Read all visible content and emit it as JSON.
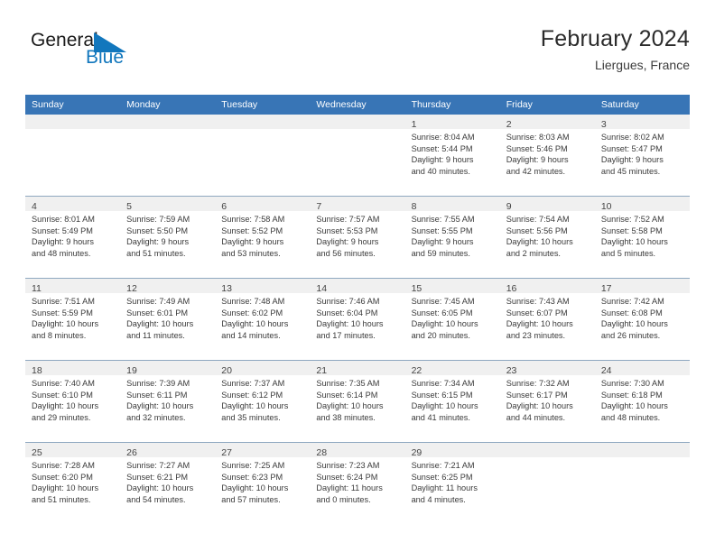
{
  "logo": {
    "word_top": "General",
    "word_bottom": "Blue",
    "triangle_color": "#1277bd"
  },
  "header": {
    "title": "February 2024",
    "subtitle": "Liergues, France"
  },
  "colors": {
    "header_blue": "#3875b6",
    "daynum_band": "#f0f0f0",
    "row_separator": "#8fa8c0",
    "text": "#3a3a3a"
  },
  "calendar": {
    "weekday_headers": [
      "Sunday",
      "Monday",
      "Tuesday",
      "Wednesday",
      "Thursday",
      "Friday",
      "Saturday"
    ],
    "weeks": [
      [
        {
          "day": "",
          "lines": []
        },
        {
          "day": "",
          "lines": []
        },
        {
          "day": "",
          "lines": []
        },
        {
          "day": "",
          "lines": []
        },
        {
          "day": "1",
          "lines": [
            "Sunrise: 8:04 AM",
            "Sunset: 5:44 PM",
            "Daylight: 9 hours",
            "and 40 minutes."
          ]
        },
        {
          "day": "2",
          "lines": [
            "Sunrise: 8:03 AM",
            "Sunset: 5:46 PM",
            "Daylight: 9 hours",
            "and 42 minutes."
          ]
        },
        {
          "day": "3",
          "lines": [
            "Sunrise: 8:02 AM",
            "Sunset: 5:47 PM",
            "Daylight: 9 hours",
            "and 45 minutes."
          ]
        }
      ],
      [
        {
          "day": "4",
          "lines": [
            "Sunrise: 8:01 AM",
            "Sunset: 5:49 PM",
            "Daylight: 9 hours",
            "and 48 minutes."
          ]
        },
        {
          "day": "5",
          "lines": [
            "Sunrise: 7:59 AM",
            "Sunset: 5:50 PM",
            "Daylight: 9 hours",
            "and 51 minutes."
          ]
        },
        {
          "day": "6",
          "lines": [
            "Sunrise: 7:58 AM",
            "Sunset: 5:52 PM",
            "Daylight: 9 hours",
            "and 53 minutes."
          ]
        },
        {
          "day": "7",
          "lines": [
            "Sunrise: 7:57 AM",
            "Sunset: 5:53 PM",
            "Daylight: 9 hours",
            "and 56 minutes."
          ]
        },
        {
          "day": "8",
          "lines": [
            "Sunrise: 7:55 AM",
            "Sunset: 5:55 PM",
            "Daylight: 9 hours",
            "and 59 minutes."
          ]
        },
        {
          "day": "9",
          "lines": [
            "Sunrise: 7:54 AM",
            "Sunset: 5:56 PM",
            "Daylight: 10 hours",
            "and 2 minutes."
          ]
        },
        {
          "day": "10",
          "lines": [
            "Sunrise: 7:52 AM",
            "Sunset: 5:58 PM",
            "Daylight: 10 hours",
            "and 5 minutes."
          ]
        }
      ],
      [
        {
          "day": "11",
          "lines": [
            "Sunrise: 7:51 AM",
            "Sunset: 5:59 PM",
            "Daylight: 10 hours",
            "and 8 minutes."
          ]
        },
        {
          "day": "12",
          "lines": [
            "Sunrise: 7:49 AM",
            "Sunset: 6:01 PM",
            "Daylight: 10 hours",
            "and 11 minutes."
          ]
        },
        {
          "day": "13",
          "lines": [
            "Sunrise: 7:48 AM",
            "Sunset: 6:02 PM",
            "Daylight: 10 hours",
            "and 14 minutes."
          ]
        },
        {
          "day": "14",
          "lines": [
            "Sunrise: 7:46 AM",
            "Sunset: 6:04 PM",
            "Daylight: 10 hours",
            "and 17 minutes."
          ]
        },
        {
          "day": "15",
          "lines": [
            "Sunrise: 7:45 AM",
            "Sunset: 6:05 PM",
            "Daylight: 10 hours",
            "and 20 minutes."
          ]
        },
        {
          "day": "16",
          "lines": [
            "Sunrise: 7:43 AM",
            "Sunset: 6:07 PM",
            "Daylight: 10 hours",
            "and 23 minutes."
          ]
        },
        {
          "day": "17",
          "lines": [
            "Sunrise: 7:42 AM",
            "Sunset: 6:08 PM",
            "Daylight: 10 hours",
            "and 26 minutes."
          ]
        }
      ],
      [
        {
          "day": "18",
          "lines": [
            "Sunrise: 7:40 AM",
            "Sunset: 6:10 PM",
            "Daylight: 10 hours",
            "and 29 minutes."
          ]
        },
        {
          "day": "19",
          "lines": [
            "Sunrise: 7:39 AM",
            "Sunset: 6:11 PM",
            "Daylight: 10 hours",
            "and 32 minutes."
          ]
        },
        {
          "day": "20",
          "lines": [
            "Sunrise: 7:37 AM",
            "Sunset: 6:12 PM",
            "Daylight: 10 hours",
            "and 35 minutes."
          ]
        },
        {
          "day": "21",
          "lines": [
            "Sunrise: 7:35 AM",
            "Sunset: 6:14 PM",
            "Daylight: 10 hours",
            "and 38 minutes."
          ]
        },
        {
          "day": "22",
          "lines": [
            "Sunrise: 7:34 AM",
            "Sunset: 6:15 PM",
            "Daylight: 10 hours",
            "and 41 minutes."
          ]
        },
        {
          "day": "23",
          "lines": [
            "Sunrise: 7:32 AM",
            "Sunset: 6:17 PM",
            "Daylight: 10 hours",
            "and 44 minutes."
          ]
        },
        {
          "day": "24",
          "lines": [
            "Sunrise: 7:30 AM",
            "Sunset: 6:18 PM",
            "Daylight: 10 hours",
            "and 48 minutes."
          ]
        }
      ],
      [
        {
          "day": "25",
          "lines": [
            "Sunrise: 7:28 AM",
            "Sunset: 6:20 PM",
            "Daylight: 10 hours",
            "and 51 minutes."
          ]
        },
        {
          "day": "26",
          "lines": [
            "Sunrise: 7:27 AM",
            "Sunset: 6:21 PM",
            "Daylight: 10 hours",
            "and 54 minutes."
          ]
        },
        {
          "day": "27",
          "lines": [
            "Sunrise: 7:25 AM",
            "Sunset: 6:23 PM",
            "Daylight: 10 hours",
            "and 57 minutes."
          ]
        },
        {
          "day": "28",
          "lines": [
            "Sunrise: 7:23 AM",
            "Sunset: 6:24 PM",
            "Daylight: 11 hours",
            "and 0 minutes."
          ]
        },
        {
          "day": "29",
          "lines": [
            "Sunrise: 7:21 AM",
            "Sunset: 6:25 PM",
            "Daylight: 11 hours",
            "and 4 minutes."
          ]
        },
        {
          "day": "",
          "lines": []
        },
        {
          "day": "",
          "lines": []
        }
      ]
    ]
  }
}
